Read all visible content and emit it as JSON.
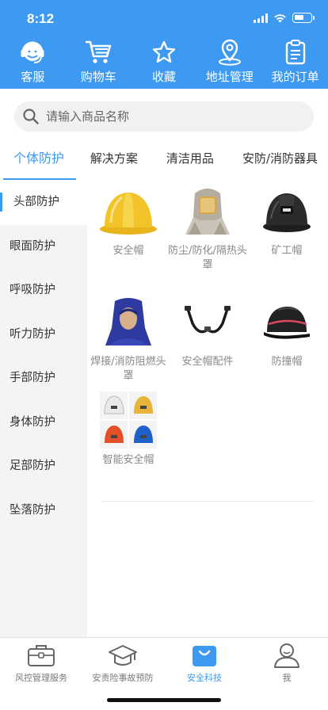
{
  "status_bar": {
    "time": "8:12"
  },
  "quick_nav": [
    {
      "label": "客服",
      "icon": "headset-icon"
    },
    {
      "label": "购物车",
      "icon": "cart-icon"
    },
    {
      "label": "收藏",
      "icon": "star-icon"
    },
    {
      "label": "地址管理",
      "icon": "location-pin-icon"
    },
    {
      "label": "我的订单",
      "icon": "order-list-icon"
    }
  ],
  "search": {
    "placeholder": "请输入商品名称"
  },
  "tabs": [
    {
      "label": "个体防护",
      "active": true
    },
    {
      "label": "解决方案"
    },
    {
      "label": "清洁用品"
    },
    {
      "label": "安防/消防器具"
    }
  ],
  "sidebar": [
    {
      "label": "头部防护",
      "active": true
    },
    {
      "label": "眼面防护"
    },
    {
      "label": "呼吸防护"
    },
    {
      "label": "听力防护"
    },
    {
      "label": "手部防护"
    },
    {
      "label": "身体防护"
    },
    {
      "label": "足部防护"
    },
    {
      "label": "坠落防护"
    }
  ],
  "products": [
    {
      "name": "安全帽",
      "image": "yellow-safety-helmet"
    },
    {
      "name": "防尘/防化/隔热头罩",
      "image": "aluminized-heat-hood"
    },
    {
      "name": "矿工帽",
      "image": "black-miner-helmet"
    },
    {
      "name": "焊接/消防阻燃头罩",
      "image": "blue-welding-hood"
    },
    {
      "name": "安全帽配件",
      "image": "helmet-chin-strap"
    },
    {
      "name": "防撞帽",
      "image": "bump-cap"
    },
    {
      "name": "智能安全帽",
      "image": "smart-helmets-grid"
    }
  ],
  "bottom_nav": [
    {
      "label": "风控管理服务",
      "icon": "briefcase-icon"
    },
    {
      "label": "安责险事故预防",
      "icon": "graduation-cap-icon"
    },
    {
      "label": "安全科技",
      "icon": "shopping-bag-icon",
      "active": true
    },
    {
      "label": "我",
      "icon": "user-icon"
    }
  ],
  "colors": {
    "primary": "#3d9af0",
    "sidebar_bg": "#f4f4f4",
    "text": "#333333",
    "muted": "#888888"
  }
}
